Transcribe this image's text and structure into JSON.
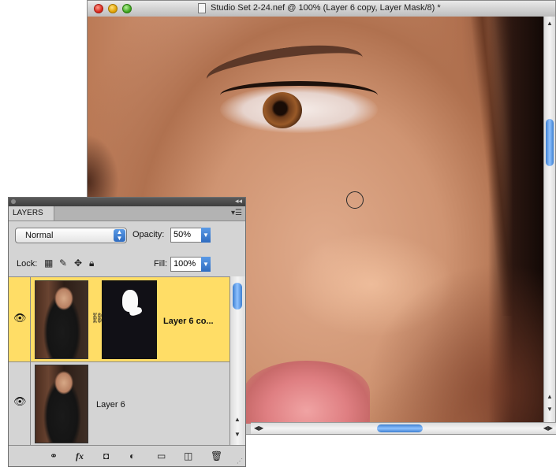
{
  "document": {
    "title": "Studio Set 2-24.nef @ 100% (Layer 6 copy, Layer Mask/8) *",
    "icons": {
      "close": "close-icon",
      "minimize": "minimize-icon",
      "zoom": "zoom-icon",
      "document": "document-icon",
      "brush_cursor": "brush-cursor-circle"
    }
  },
  "layers_panel": {
    "tab_label": "LAYERS",
    "collapse_label": "◂◂",
    "menu_label": "▾☰",
    "blend_mode": "Normal",
    "opacity_label": "Opacity:",
    "opacity_value": "50%",
    "lock_label": "Lock:",
    "fill_label": "Fill:",
    "fill_value": "100%",
    "layers": [
      {
        "name": "Layer 6 co...",
        "visible": true,
        "selected": true,
        "has_mask": true
      },
      {
        "name": "Layer 6",
        "visible": true,
        "selected": false,
        "has_mask": false
      }
    ],
    "footer_icons": [
      "link-layers-icon",
      "fx-icon",
      "add-mask-icon",
      "adjustment-layer-icon",
      "group-folder-icon",
      "new-layer-icon",
      "trash-icon"
    ],
    "colors": {
      "selected_row": "#ffdd66",
      "panel_bg": "#d4d4d4",
      "scroll_thumb": "#3d7fd0"
    }
  }
}
